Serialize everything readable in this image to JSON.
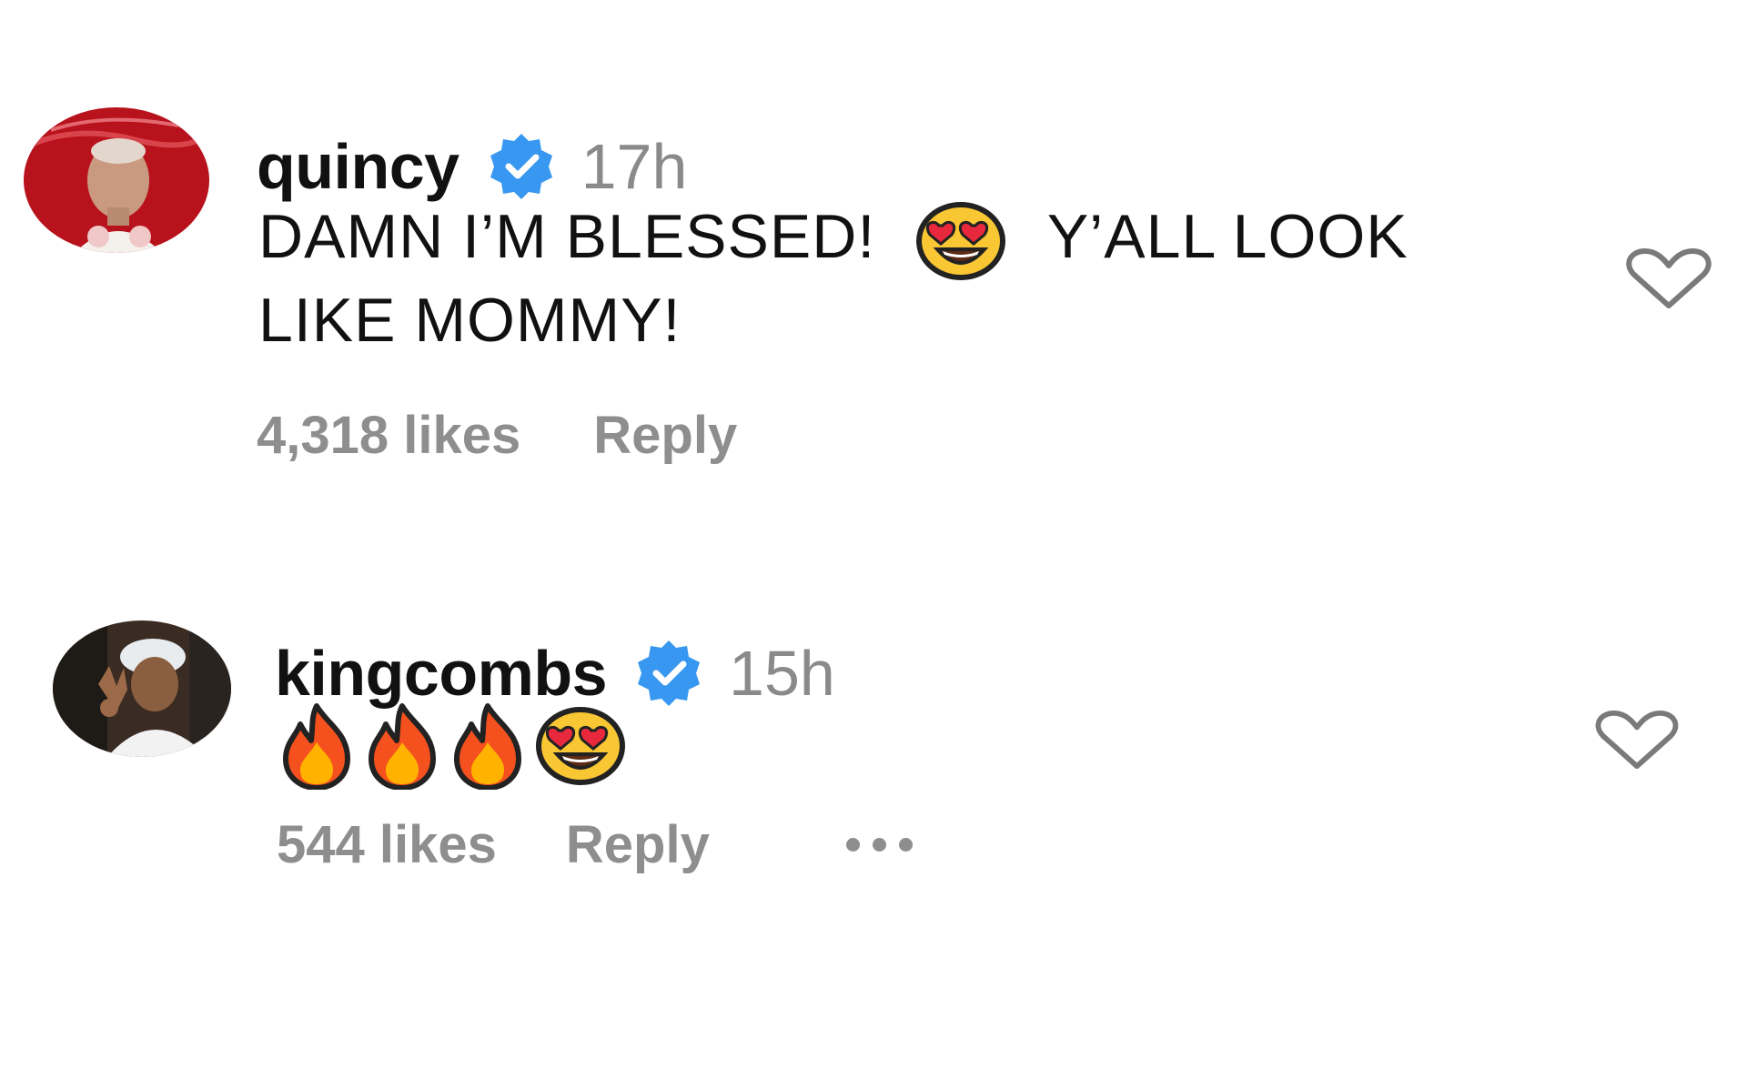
{
  "comments": [
    {
      "username": "quincy",
      "time": "17h",
      "text_line1": "DAMN I’M BLESSED!",
      "text_line1_after": "Y’ALL LOOK",
      "text_line2": "LIKE MOMMY!",
      "likes": "4,318 likes",
      "reply": "Reply"
    },
    {
      "username": "kingcombs",
      "time": "15h",
      "likes": "544 likes",
      "reply": "Reply"
    }
  ],
  "icons": {
    "verified": "verified-badge-icon",
    "heart": "heart-outline-icon",
    "more": "more-dots-icon",
    "fire": "fire-emoji",
    "heart_eyes": "heart-eyes-emoji"
  },
  "colors": {
    "verified_blue": "#3897f0",
    "muted_text": "#8e8e8e",
    "timestamp": "#8a8a8a"
  }
}
